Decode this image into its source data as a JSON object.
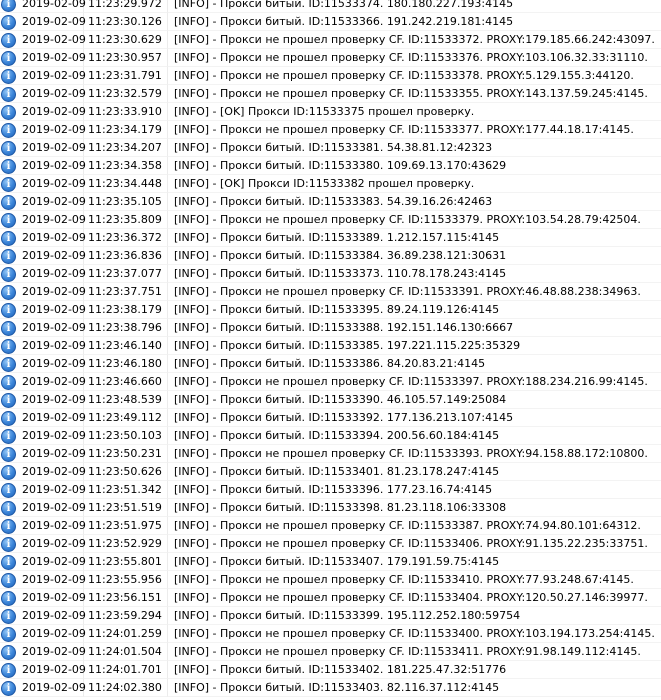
{
  "icon": {
    "name": "info-icon",
    "glyph": "i",
    "color": "#3a84d8"
  },
  "rows": [
    {
      "date": "2019-02-09",
      "time": "11:23:29.972",
      "msg": "[INFO] - Прокси битый. ID:11533374. 180.180.227.193:4145"
    },
    {
      "date": "2019-02-09",
      "time": "11:23:30.126",
      "msg": "[INFO] - Прокси битый. ID:11533366. 191.242.219.181:4145"
    },
    {
      "date": "2019-02-09",
      "time": "11:23:30.629",
      "msg": "[INFO] - Прокси не прошел проверку CF. ID:11533372. PROXY:179.185.66.242:43097."
    },
    {
      "date": "2019-02-09",
      "time": "11:23:30.957",
      "msg": "[INFO] - Прокси не прошел проверку CF. ID:11533376. PROXY:103.106.32.33:31110."
    },
    {
      "date": "2019-02-09",
      "time": "11:23:31.791",
      "msg": "[INFO] - Прокси не прошел проверку CF. ID:11533378. PROXY:5.129.155.3:44120."
    },
    {
      "date": "2019-02-09",
      "time": "11:23:32.579",
      "msg": "[INFO] - Прокси не прошел проверку CF. ID:11533355. PROXY:143.137.59.245:4145."
    },
    {
      "date": "2019-02-09",
      "time": "11:23:33.910",
      "msg": "[INFO] - [OK] Прокси ID:11533375 прошел проверку."
    },
    {
      "date": "2019-02-09",
      "time": "11:23:34.179",
      "msg": "[INFO] - Прокси не прошел проверку CF. ID:11533377. PROXY:177.44.18.17:4145."
    },
    {
      "date": "2019-02-09",
      "time": "11:23:34.207",
      "msg": "[INFO] - Прокси битый. ID:11533381. 54.38.81.12:42323"
    },
    {
      "date": "2019-02-09",
      "time": "11:23:34.358",
      "msg": "[INFO] - Прокси битый. ID:11533380. 109.69.13.170:43629"
    },
    {
      "date": "2019-02-09",
      "time": "11:23:34.448",
      "msg": "[INFO] - [OK] Прокси ID:11533382 прошел проверку."
    },
    {
      "date": "2019-02-09",
      "time": "11:23:35.105",
      "msg": "[INFO] - Прокси битый. ID:11533383. 54.39.16.26:42463"
    },
    {
      "date": "2019-02-09",
      "time": "11:23:35.809",
      "msg": "[INFO] - Прокси не прошел проверку CF. ID:11533379. PROXY:103.54.28.79:42504."
    },
    {
      "date": "2019-02-09",
      "time": "11:23:36.372",
      "msg": "[INFO] - Прокси битый. ID:11533389. 1.212.157.115:4145"
    },
    {
      "date": "2019-02-09",
      "time": "11:23:36.836",
      "msg": "[INFO] - Прокси битый. ID:11533384. 36.89.238.121:30631"
    },
    {
      "date": "2019-02-09",
      "time": "11:23:37.077",
      "msg": "[INFO] - Прокси битый. ID:11533373. 110.78.178.243:4145"
    },
    {
      "date": "2019-02-09",
      "time": "11:23:37.751",
      "msg": "[INFO] - Прокси не прошел проверку CF. ID:11533391. PROXY:46.48.88.238:34963."
    },
    {
      "date": "2019-02-09",
      "time": "11:23:38.179",
      "msg": "[INFO] - Прокси битый. ID:11533395. 89.24.119.126:4145"
    },
    {
      "date": "2019-02-09",
      "time": "11:23:38.796",
      "msg": "[INFO] - Прокси битый. ID:11533388. 192.151.146.130:6667"
    },
    {
      "date": "2019-02-09",
      "time": "11:23:46.140",
      "msg": "[INFO] - Прокси битый. ID:11533385. 197.221.115.225:35329"
    },
    {
      "date": "2019-02-09",
      "time": "11:23:46.180",
      "msg": "[INFO] - Прокси битый. ID:11533386. 84.20.83.21:4145"
    },
    {
      "date": "2019-02-09",
      "time": "11:23:46.660",
      "msg": "[INFO] - Прокси не прошел проверку CF. ID:11533397. PROXY:188.234.216.99:4145."
    },
    {
      "date": "2019-02-09",
      "time": "11:23:48.539",
      "msg": "[INFO] - Прокси битый. ID:11533390. 46.105.57.149:25084"
    },
    {
      "date": "2019-02-09",
      "time": "11:23:49.112",
      "msg": "[INFO] - Прокси битый. ID:11533392. 177.136.213.107:4145"
    },
    {
      "date": "2019-02-09",
      "time": "11:23:50.103",
      "msg": "[INFO] - Прокси битый. ID:11533394. 200.56.60.184:4145"
    },
    {
      "date": "2019-02-09",
      "time": "11:23:50.231",
      "msg": "[INFO] - Прокси не прошел проверку CF. ID:11533393. PROXY:94.158.88.172:10800."
    },
    {
      "date": "2019-02-09",
      "time": "11:23:50.626",
      "msg": "[INFO] - Прокси битый. ID:11533401. 81.23.178.247:4145"
    },
    {
      "date": "2019-02-09",
      "time": "11:23:51.342",
      "msg": "[INFO] - Прокси битый. ID:11533396. 177.23.16.74:4145"
    },
    {
      "date": "2019-02-09",
      "time": "11:23:51.519",
      "msg": "[INFO] - Прокси битый. ID:11533398. 81.23.118.106:33308"
    },
    {
      "date": "2019-02-09",
      "time": "11:23:51.975",
      "msg": "[INFO] - Прокси не прошел проверку CF. ID:11533387. PROXY:74.94.80.101:64312."
    },
    {
      "date": "2019-02-09",
      "time": "11:23:52.929",
      "msg": "[INFO] - Прокси не прошел проверку CF. ID:11533406. PROXY:91.135.22.235:33751."
    },
    {
      "date": "2019-02-09",
      "time": "11:23:55.801",
      "msg": "[INFO] - Прокси битый. ID:11533407. 179.191.59.75:4145"
    },
    {
      "date": "2019-02-09",
      "time": "11:23:55.956",
      "msg": "[INFO] - Прокси не прошел проверку CF. ID:11533410. PROXY:77.93.248.67:4145."
    },
    {
      "date": "2019-02-09",
      "time": "11:23:56.151",
      "msg": "[INFO] - Прокси не прошел проверку CF. ID:11533404. PROXY:120.50.27.146:39977."
    },
    {
      "date": "2019-02-09",
      "time": "11:23:59.294",
      "msg": "[INFO] - Прокси битый. ID:11533399. 195.112.252.180:59754"
    },
    {
      "date": "2019-02-09",
      "time": "11:24:01.259",
      "msg": "[INFO] - Прокси не прошел проверку CF. ID:11533400. PROXY:103.194.173.254:4145."
    },
    {
      "date": "2019-02-09",
      "time": "11:24:01.504",
      "msg": "[INFO] - Прокси не прошел проверку CF. ID:11533411. PROXY:91.98.149.112:4145."
    },
    {
      "date": "2019-02-09",
      "time": "11:24:01.701",
      "msg": "[INFO] - Прокси битый. ID:11533402. 181.225.47.32:51776"
    },
    {
      "date": "2019-02-09",
      "time": "11:24:02.380",
      "msg": "[INFO] - Прокси битый. ID:11533403. 82.116.37.112:4145"
    }
  ]
}
